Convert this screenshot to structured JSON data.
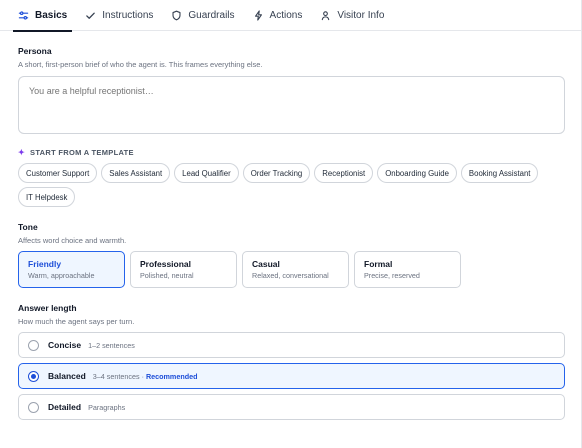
{
  "tabs": [
    {
      "label": "Basics",
      "icon": "sliders-icon",
      "active": true
    },
    {
      "label": "Instructions",
      "icon": "check-icon"
    },
    {
      "label": "Guardrails",
      "icon": "shield-icon"
    },
    {
      "label": "Actions",
      "icon": "bolt-icon"
    },
    {
      "label": "Visitor Info",
      "icon": "user-icon"
    }
  ],
  "persona": {
    "title": "Persona",
    "subtitle": "A short, first-person brief of who the agent is. This frames everything else.",
    "placeholder": "You are a helpful receptionist…",
    "value": ""
  },
  "templates": {
    "heading": "START FROM A TEMPLATE",
    "icon": "sparkle-icon",
    "chips": [
      "Customer Support",
      "Sales Assistant",
      "Lead Qualifier",
      "Order Tracking",
      "Receptionist",
      "Onboarding Guide",
      "Booking Assistant",
      "IT Helpdesk"
    ]
  },
  "tone": {
    "title": "Tone",
    "subtitle": "Affects word choice and warmth.",
    "selected": "Friendly",
    "options": [
      {
        "name": "Friendly",
        "desc": "Warm, approachable"
      },
      {
        "name": "Professional",
        "desc": "Polished, neutral"
      },
      {
        "name": "Casual",
        "desc": "Relaxed, conversational"
      },
      {
        "name": "Formal",
        "desc": "Precise, reserved"
      }
    ]
  },
  "answer_length": {
    "title": "Answer length",
    "subtitle": "How much the agent says per turn.",
    "selected": "Balanced",
    "options": [
      {
        "name": "Concise",
        "desc": "1–2 sentences"
      },
      {
        "name": "Balanced",
        "desc": "3–4 sentences",
        "sep": "·",
        "badge": "Recommended"
      },
      {
        "name": "Detailed",
        "desc": "Paragraphs"
      }
    ]
  },
  "colors": {
    "accent": "#2563eb",
    "selected_bg": "#eff6ff",
    "border": "#d1d5db"
  }
}
